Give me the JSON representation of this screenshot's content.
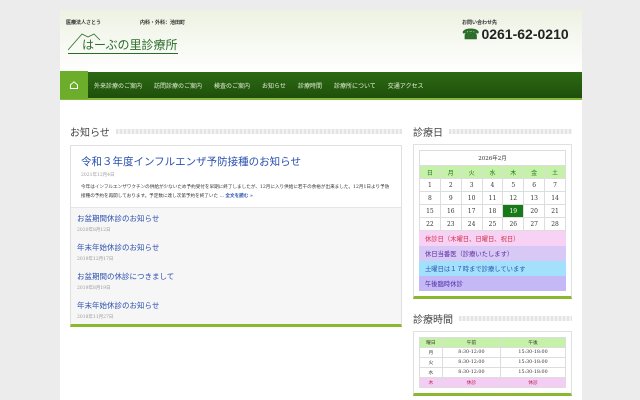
{
  "header": {
    "corp": "医療法人さとう",
    "dept": "内科・外科：池田町",
    "logo": "はーぶの里診療所",
    "contact_label": "お問い合わせ先",
    "phone": "0261-62-0210"
  },
  "nav": {
    "items": [
      "外来診療のご案内",
      "訪問診療のご案内",
      "検査のご案内",
      "お知らせ",
      "診療時間",
      "診療所について",
      "交通アクセス"
    ]
  },
  "news": {
    "title": "お知らせ",
    "featured": {
      "title": "令和３年度インフルエンザ予防接種のお知らせ",
      "date": "2021年12月4日",
      "excerpt": "今年はインフルエンザワクチンの供給が少ないため予約受付を早期に終了しましたが、12月に入り供給に若干の余裕が出来ました。12月1日より予防接種の予約を再開しております。予定数に達し次第予約を終了いた ...",
      "more": "全文を読む »"
    },
    "items": [
      {
        "title": "お盆期間休診のお知らせ",
        "date": "2020年8月12日"
      },
      {
        "title": "年末年始休診のお知らせ",
        "date": "2019年12月17日"
      },
      {
        "title": "お盆期間の休診につきまして",
        "date": "2019年8月19日"
      },
      {
        "title": "年末年始休診のお知らせ",
        "date": "2018年11月27日"
      }
    ]
  },
  "calendar": {
    "title": "診療日",
    "month": "2026年2月",
    "weekdays": [
      "日",
      "月",
      "火",
      "水",
      "木",
      "金",
      "土"
    ],
    "weeks": [
      [
        "1",
        "2",
        "3",
        "4",
        "5",
        "6",
        "7"
      ],
      [
        "8",
        "9",
        "10",
        "11",
        "12",
        "13",
        "14"
      ],
      [
        "15",
        "16",
        "17",
        "18",
        "19",
        "20",
        "21"
      ],
      [
        "22",
        "23",
        "24",
        "25",
        "26",
        "27",
        "28"
      ]
    ],
    "today": "19",
    "legend": [
      {
        "text": "休診日（木曜日、日曜日、祝日）",
        "bg": "#f8d2f4",
        "color": "#d0304a"
      },
      {
        "text": "休日当番医（診療いたします）",
        "bg": "#d8c8f6",
        "color": "#5a2a9a"
      },
      {
        "text": "土曜日は１７時まで診療しています",
        "bg": "#a2e0fc",
        "color": "#2a55b0"
      },
      {
        "text": "午後臨時休診",
        "bg": "#c4b8f6",
        "color": "#4a2aa0"
      }
    ]
  },
  "hours": {
    "title": "診療時間",
    "headers": [
      "曜日",
      "午前",
      "午後"
    ],
    "rows": [
      [
        "月",
        "8:30-12:00",
        "15:30-18:00"
      ],
      [
        "火",
        "8:30-12:00",
        "15:30-18:00"
      ],
      [
        "水",
        "8:30-12:00",
        "15:30-18:00"
      ],
      [
        "木",
        "休診",
        "休診"
      ]
    ]
  }
}
